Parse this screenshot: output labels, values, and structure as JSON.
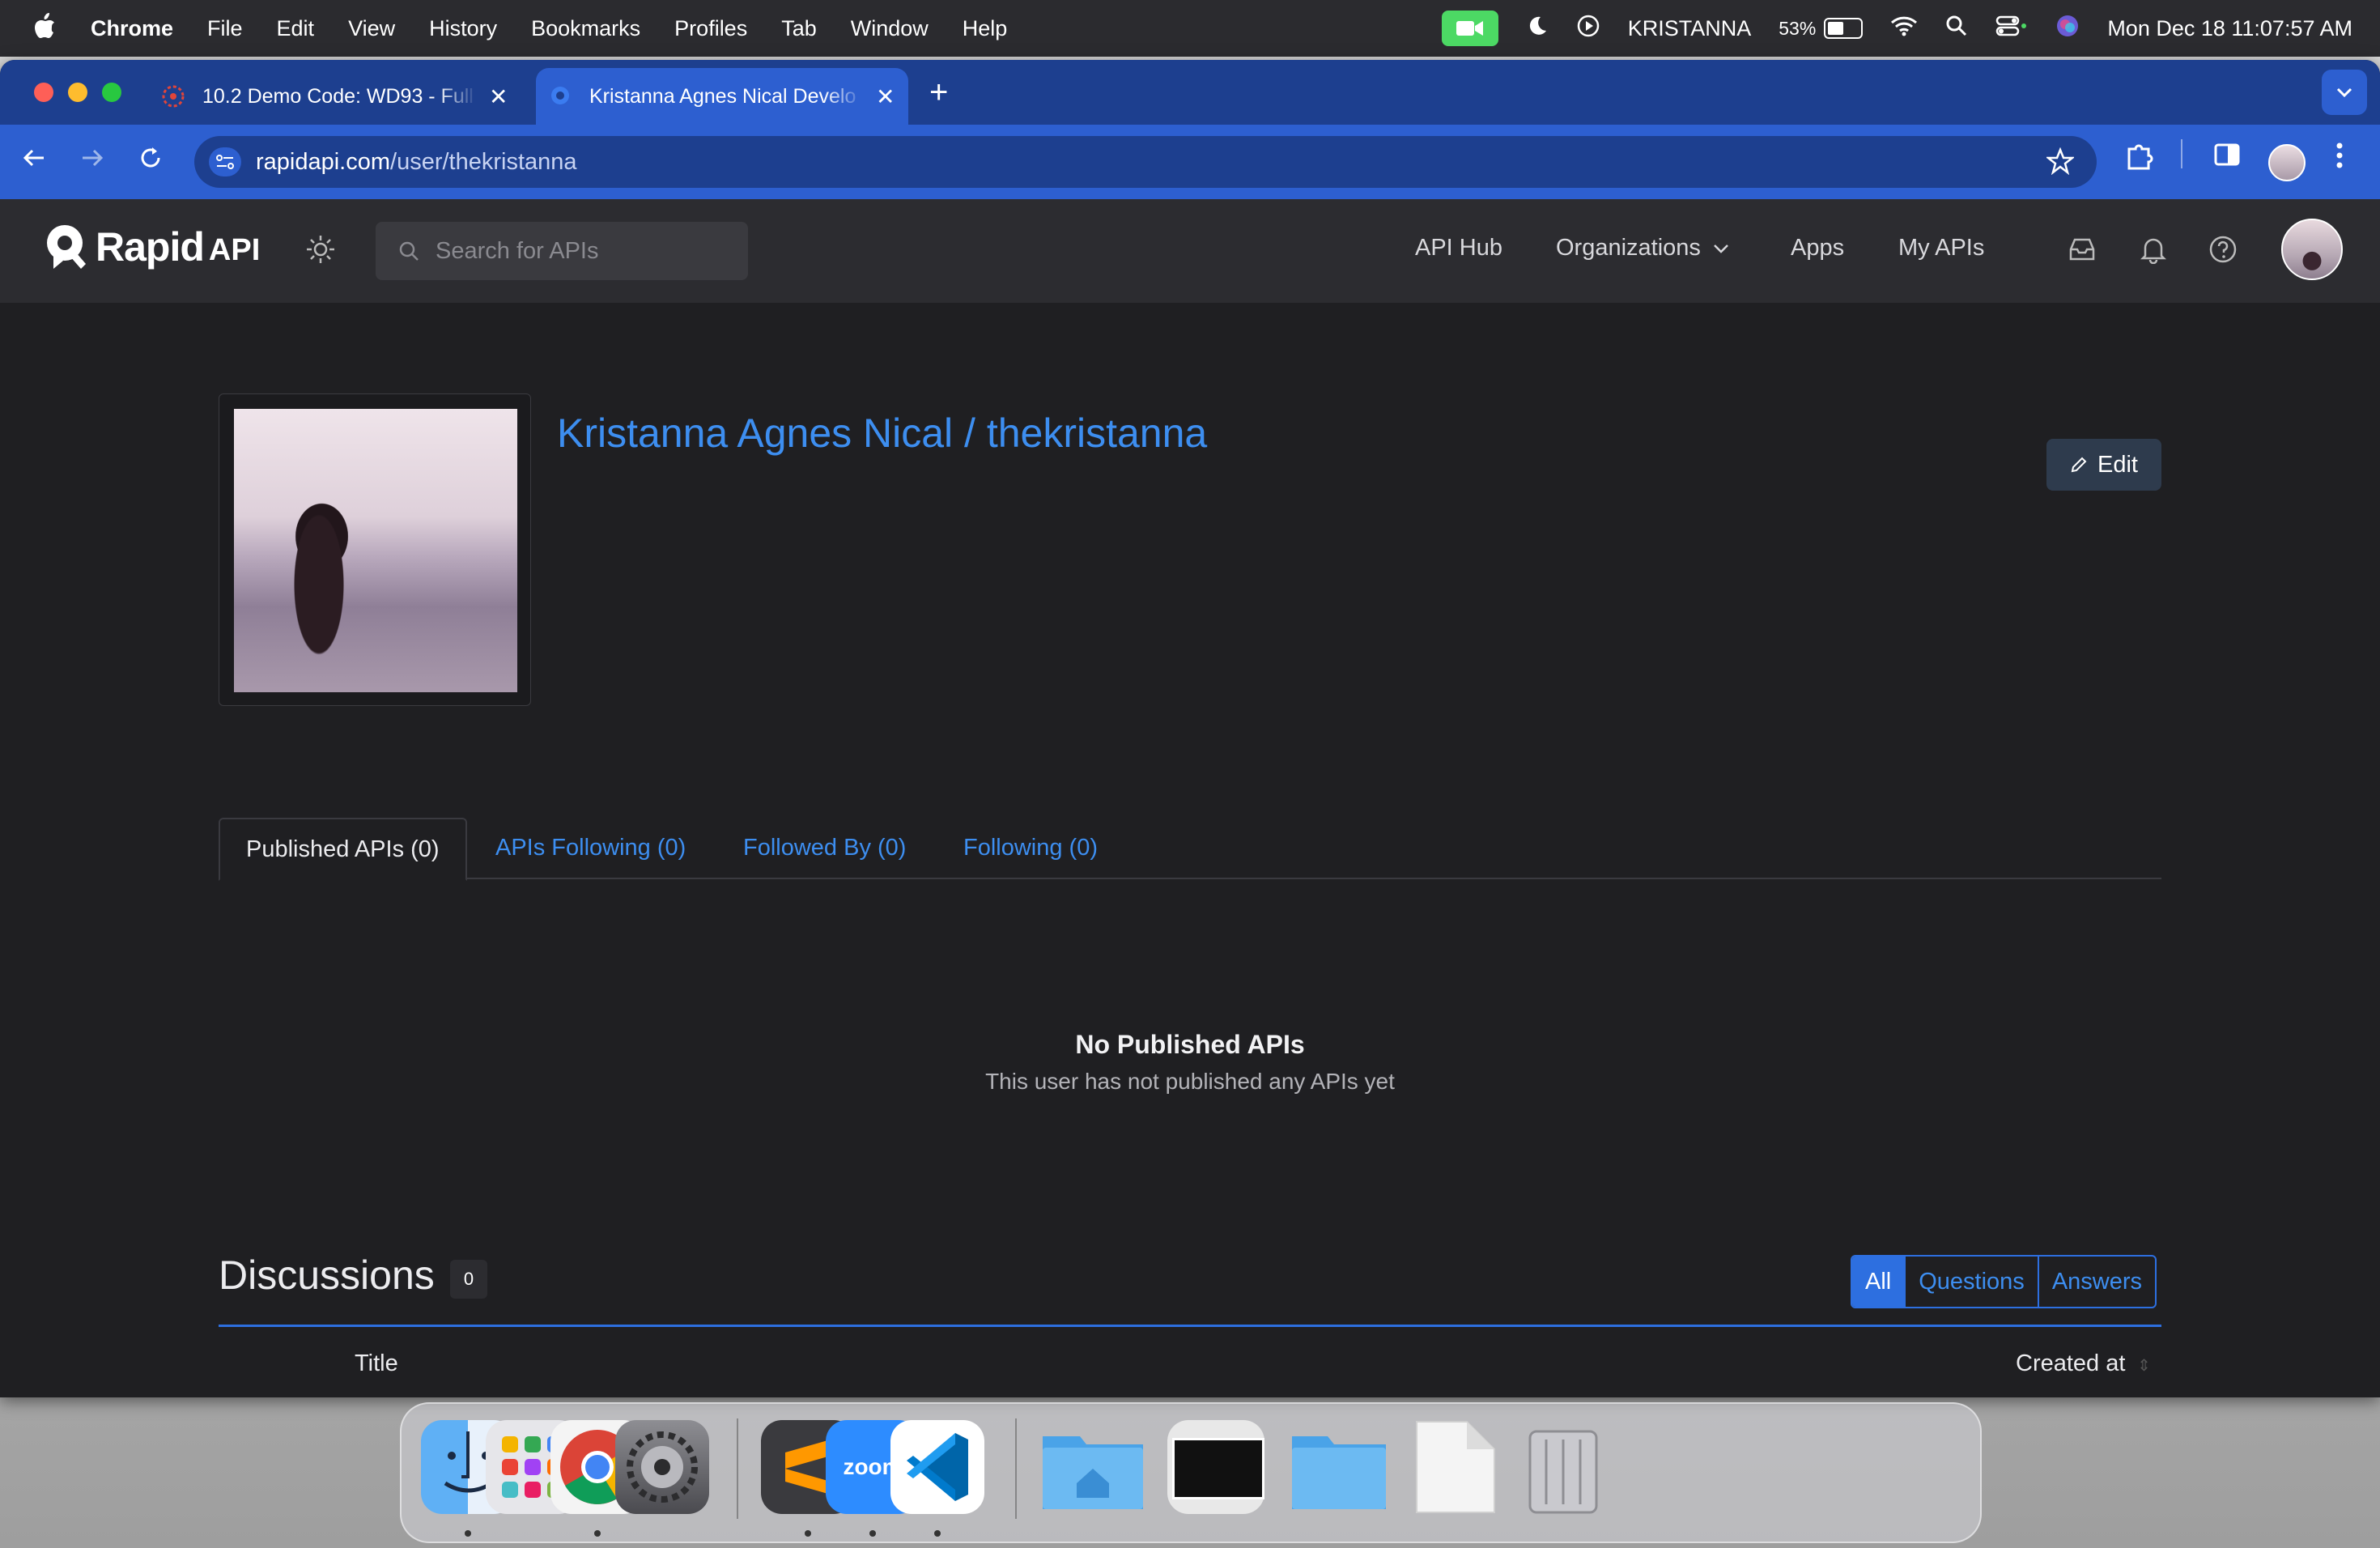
{
  "menubar": {
    "app": "Chrome",
    "items": [
      "File",
      "Edit",
      "View",
      "History",
      "Bookmarks",
      "Profiles",
      "Tab",
      "Window",
      "Help"
    ],
    "user": "KRISTANNA",
    "battery": "53%",
    "battery_level": 0.53,
    "datetime": "Mon Dec 18  11:07:57 AM"
  },
  "browser": {
    "tabs": [
      {
        "title": "10.2 Demo Code: WD93 - Full",
        "icon": "canvas-lms-icon"
      },
      {
        "title": "Kristanna Agnes Nical Develo",
        "icon": "rapidapi-icon"
      }
    ],
    "url_domain": "rapidapi.com",
    "url_path": "/user/thekristanna"
  },
  "site": {
    "logo_rapid": "Rapid",
    "logo_api": "API",
    "search_placeholder": "Search for APIs",
    "nav": {
      "api_hub": "API Hub",
      "organizations": "Organizations",
      "apps": "Apps",
      "my_apis": "My APIs"
    }
  },
  "profile": {
    "name": "Kristanna Agnes Nical / thekristanna",
    "edit_label": "Edit",
    "tabs": [
      "Published APIs (0)",
      "APIs Following (0)",
      "Followed By (0)",
      "Following (0)"
    ],
    "empty_title": "No Published APIs",
    "empty_subtitle": "This user has not published any APIs yet"
  },
  "discussions": {
    "title": "Discussions",
    "count": "0",
    "filters": [
      "All",
      "Questions",
      "Answers"
    ],
    "columns": {
      "title": "Title",
      "created": "Created at"
    }
  },
  "dock": {
    "apps": [
      "finder-icon",
      "launchpad-icon",
      "chrome-icon",
      "system-settings-icon",
      "sublime-text-icon",
      "zoom-icon",
      "vscode-icon",
      "home-folder-icon",
      "video-thumbnail-icon",
      "folder-icon",
      "document-icon",
      "trash-icon"
    ],
    "zoom_label": "zoom"
  }
}
